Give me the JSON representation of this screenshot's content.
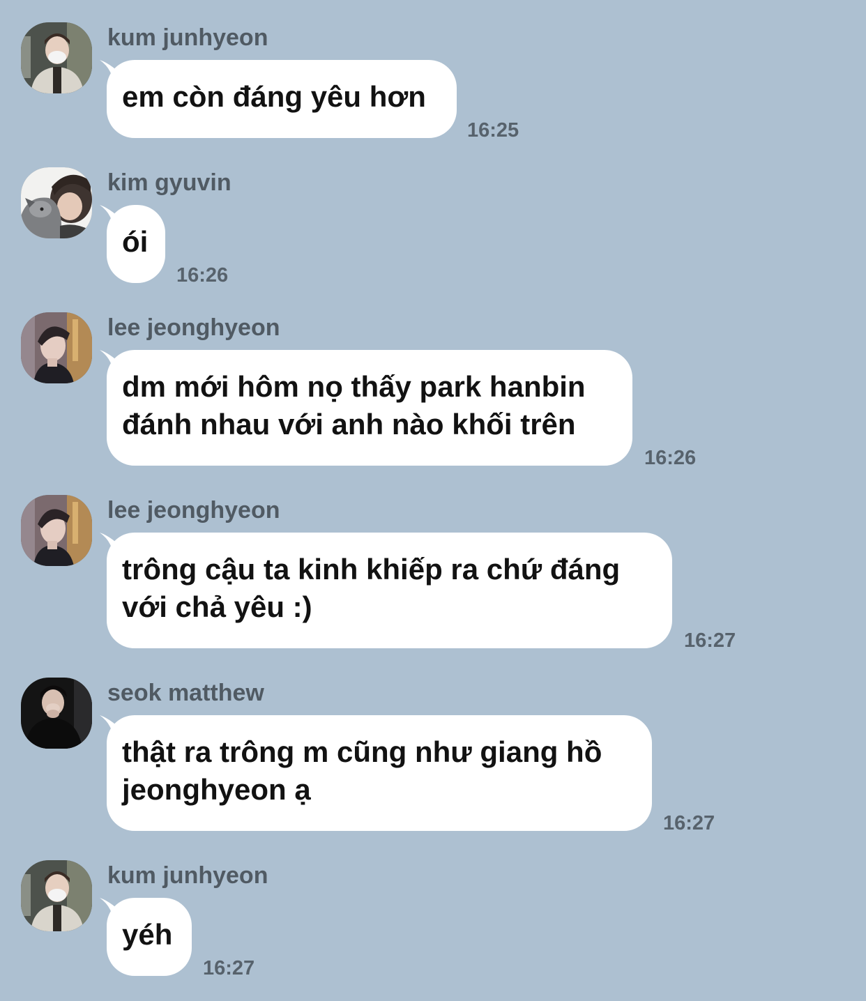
{
  "messages": [
    {
      "sender": "kum junhyeon",
      "avatar_icon": "person-masked-avatar-icon",
      "lines": [
        "em còn đáng yêu hơn"
      ],
      "time": "16:25"
    },
    {
      "sender": "kim gyuvin",
      "avatar_icon": "person-with-dog-avatar-icon",
      "lines": [
        "ói"
      ],
      "time": "16:26"
    },
    {
      "sender": "lee jeonghyeon",
      "avatar_icon": "person-profile-avatar-icon",
      "lines": [
        "dm mới hôm nọ thấy park hanbin",
        "đánh nhau với anh nào khối trên"
      ],
      "time": "16:26"
    },
    {
      "sender": "lee jeonghyeon",
      "avatar_icon": "person-profile-avatar-icon",
      "lines": [
        "trông cậu ta kinh khiếp ra chứ đáng",
        "với chả yêu :)"
      ],
      "time": "16:27"
    },
    {
      "sender": "seok matthew",
      "avatar_icon": "person-dark-avatar-icon",
      "lines": [
        "thật ra trông m cũng như giang hồ",
        "jeonghyeon ạ"
      ],
      "time": "16:27"
    },
    {
      "sender": "kum junhyeon",
      "avatar_icon": "person-masked-avatar-icon",
      "lines": [
        "yéh"
      ],
      "time": "16:27"
    }
  ],
  "colors": {
    "background": "#adc0d1",
    "bubble": "#ffffff",
    "sender_text": "#505a63",
    "time_text": "#57626c",
    "message_text": "#121212"
  }
}
